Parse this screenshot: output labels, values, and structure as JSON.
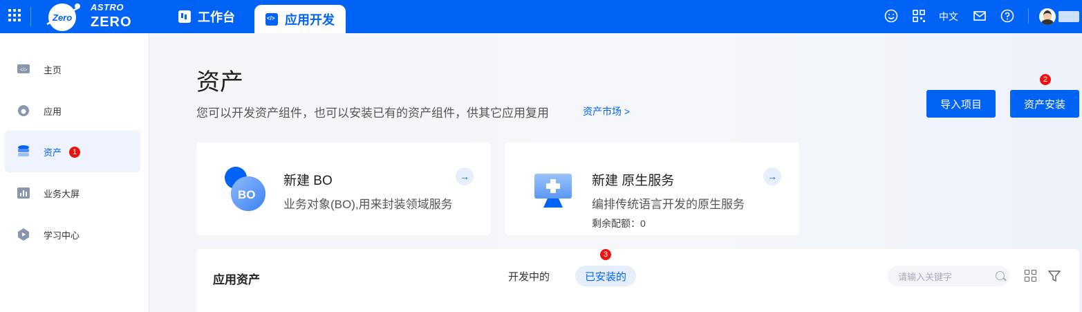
{
  "header": {
    "logo_top": "ASTRO",
    "logo_bottom": "ZERO",
    "logo_badge": "Zero",
    "tabs": [
      {
        "label": "工作台",
        "icon": "dashboard-icon"
      },
      {
        "label": "应用开发",
        "icon": "code-icon",
        "active": true
      }
    ],
    "language": "中文",
    "icons": [
      "smile-icon",
      "qrcode-icon",
      "mail-icon",
      "help-icon"
    ]
  },
  "sidebar": {
    "items": [
      {
        "label": "主页",
        "icon": "code-window-icon"
      },
      {
        "label": "应用",
        "icon": "app-cloud-icon"
      },
      {
        "label": "资产",
        "icon": "database-icon",
        "active": true,
        "badge": "1"
      },
      {
        "label": "业务大屏",
        "icon": "bar-chart-icon"
      },
      {
        "label": "学习中心",
        "icon": "learning-icon"
      }
    ]
  },
  "main": {
    "title": "资产",
    "description": "您可以开发资产组件，也可以安装已有的资产组件，供其它应用复用",
    "market_link": "资产市场 >",
    "buttons": {
      "import": "导入项目",
      "install": "资产安装",
      "install_badge": "2"
    },
    "cards": [
      {
        "title": "新建 BO",
        "desc": "业务对象(BO),用来封装领域服务",
        "icon_text": "BO"
      },
      {
        "title": "新建 原生服务",
        "desc": "编排传统语言开发的原生服务",
        "quota": "剩余配额：0"
      }
    ],
    "panel": {
      "title": "应用资产",
      "tabs": [
        "开发中的",
        "已安装的"
      ],
      "active_tab": "已安装的",
      "tab_badge": "3",
      "search_placeholder": "请输入关键字"
    }
  },
  "colors": {
    "brand": "#0063f5",
    "badge": "#e11111"
  }
}
